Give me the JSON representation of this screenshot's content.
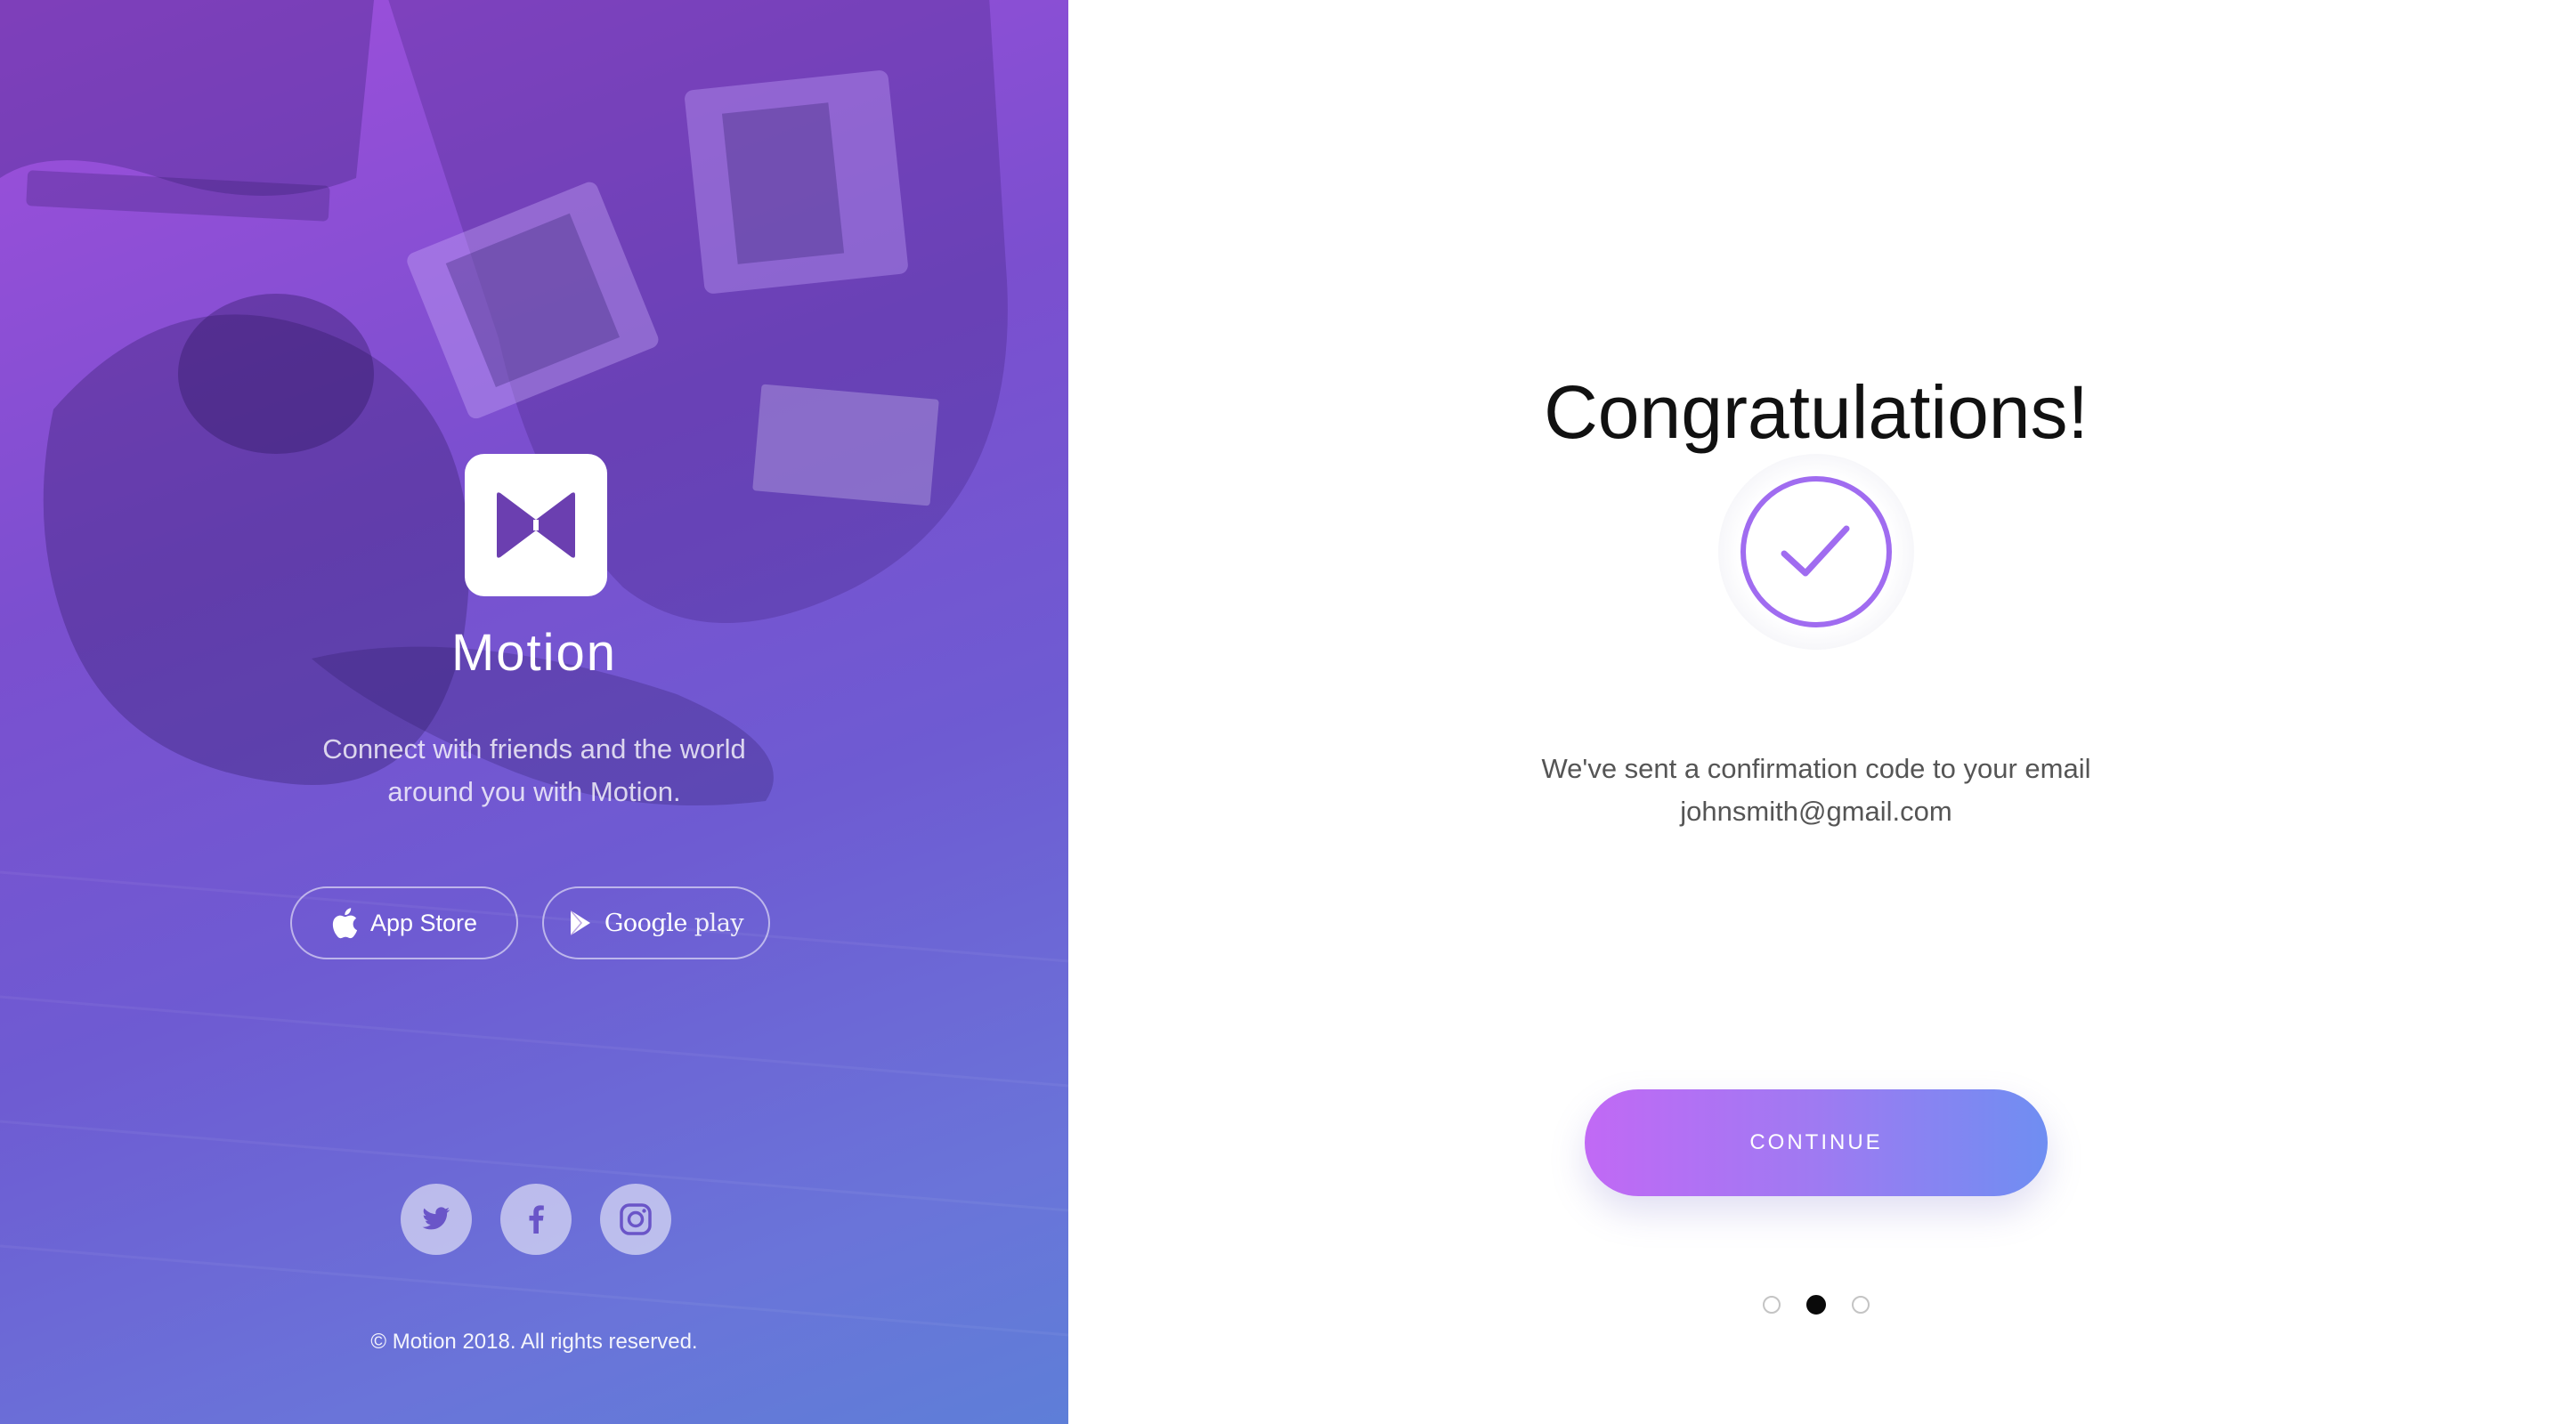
{
  "brand": {
    "name": "Motion",
    "tagline_line1": "Connect with friends and the world",
    "tagline_line2": "around you with Motion.",
    "logo_icon": "bowtie-logo-icon"
  },
  "stores": {
    "app_store": {
      "label": "App Store",
      "icon": "apple-icon"
    },
    "google_play": {
      "label_main": "Google",
      "label_sub": " play",
      "icon": "play-triangle-icon"
    }
  },
  "social": [
    {
      "name": "twitter",
      "icon": "twitter-icon"
    },
    {
      "name": "facebook",
      "icon": "facebook-icon"
    },
    {
      "name": "instagram",
      "icon": "instagram-icon"
    }
  ],
  "footer": {
    "copyright": "© Motion 2018. All rights reserved."
  },
  "main": {
    "title": "Congratulations!",
    "status_icon": "check-circle-icon",
    "message_line1": "We've sent a confirmation code to your email",
    "email": "johnsmith@gmail.com",
    "continue_label": "CONTINUE"
  },
  "pagination": {
    "total": 3,
    "current": 2
  },
  "colors": {
    "accent_purple": "#a06cf0",
    "gradient_start": "#c169f5",
    "gradient_end": "#6f8ef2",
    "panel_purple": "#7b4fcf"
  }
}
